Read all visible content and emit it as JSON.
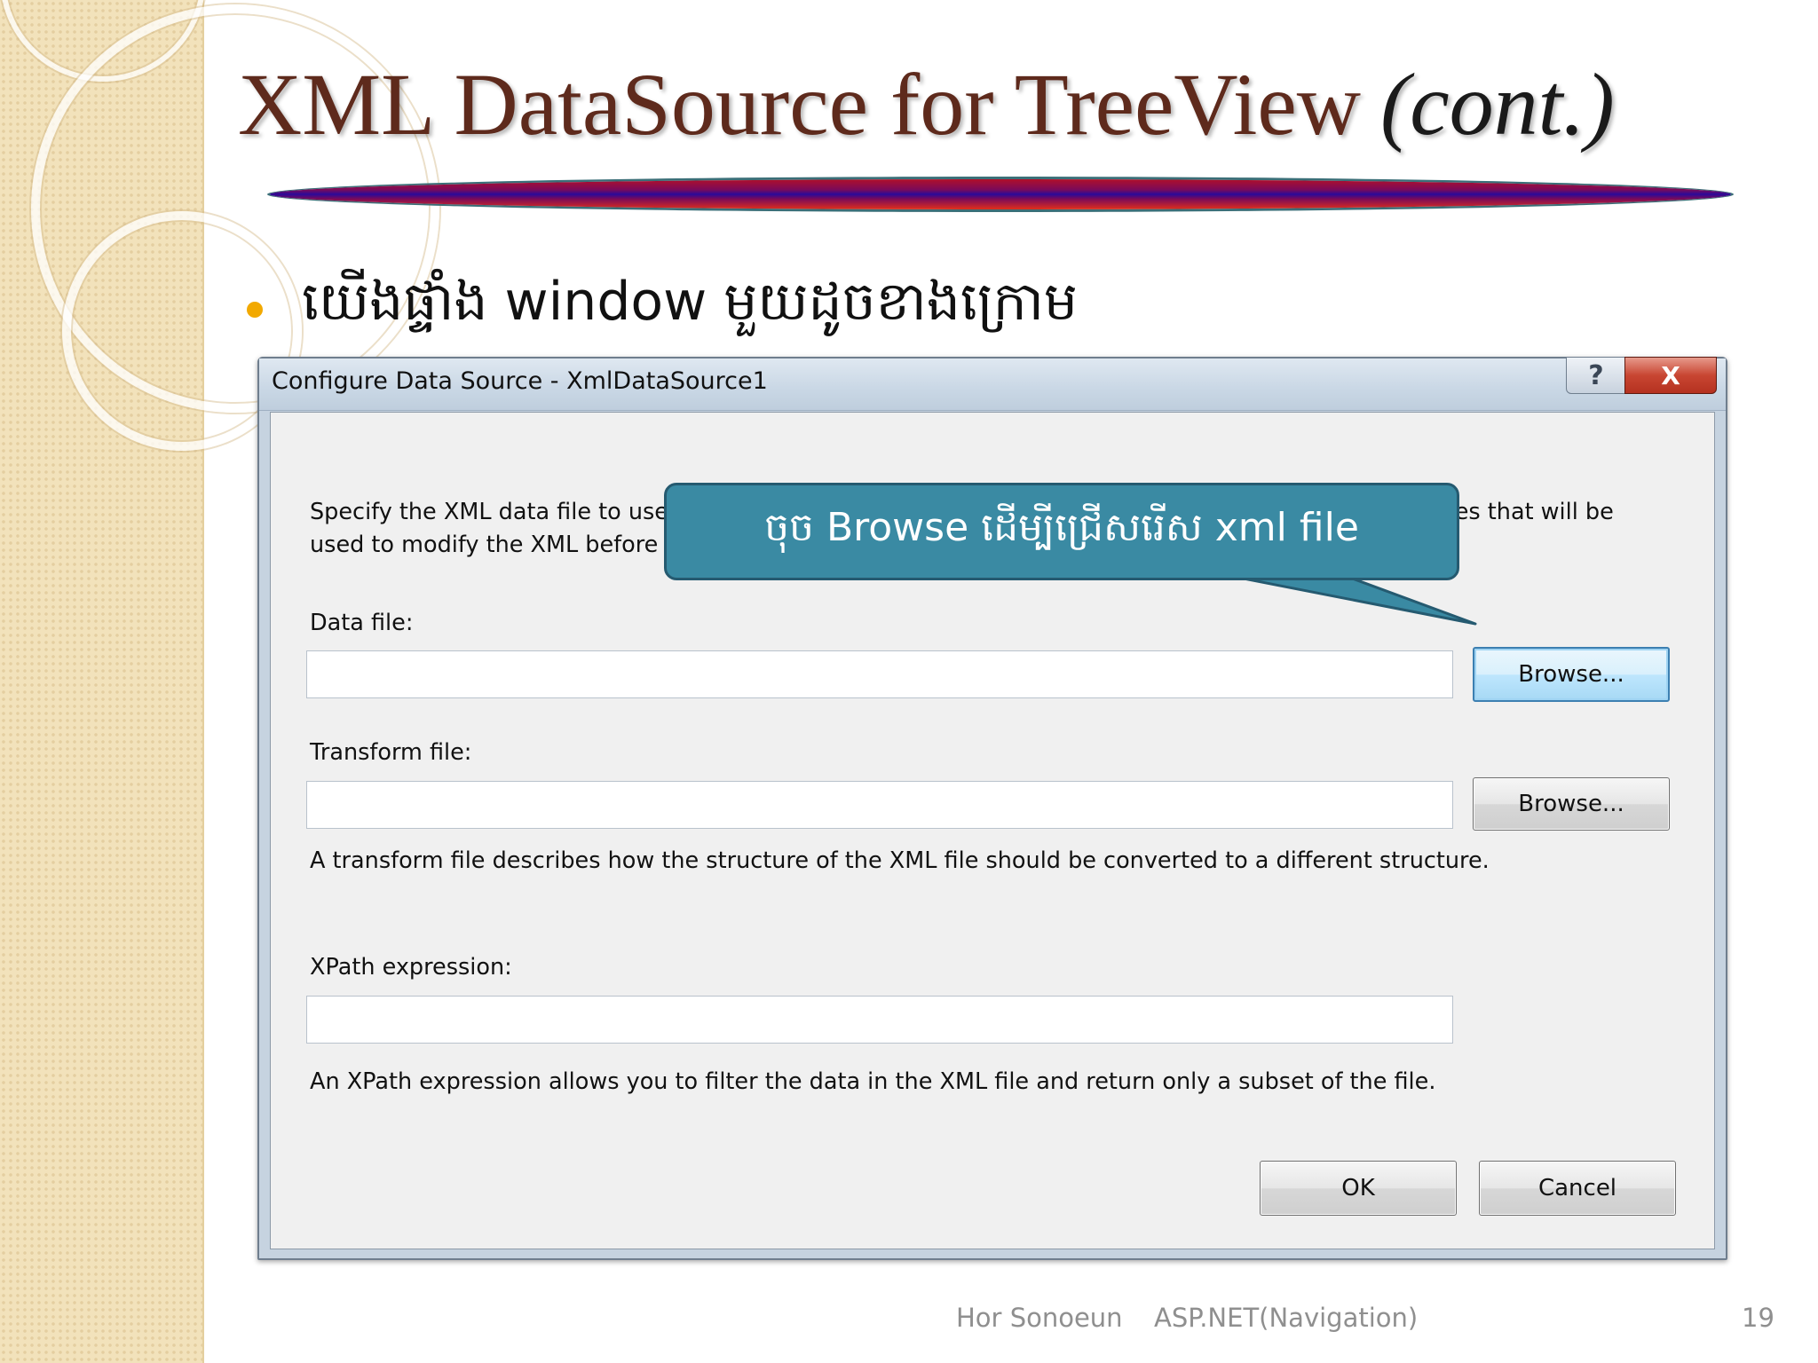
{
  "slide": {
    "title_main": "XML DataSource for TreeView",
    "title_suffix": "(cont.)",
    "bullet": "យើងផ្ទាំង window មួយដូចខាងក្រោម",
    "callout": "ចុច Browse ដើម្បីជ្រើសរើស xml file",
    "footer_author": "Hor Sonoeun",
    "footer_topic": "ASP.NET(Navigation)",
    "page_number": "19",
    "colors": {
      "title": "#5e2a1c",
      "bullet": "#f2a900",
      "callout_fill": "#3a8aa3",
      "left_band": "#f2e2bb"
    }
  },
  "dialog": {
    "title": "Configure Data Source - XmlDataSource1",
    "help_label": "?",
    "close_label": "X",
    "description": "Specify the XML data file to use as the source for this control. You can optionally specify additional files that will be used to modify the XML before it is used by the control.",
    "data_file": {
      "label": "Data file:",
      "value": "",
      "browse_label": "Browse..."
    },
    "transform_file": {
      "label": "Transform file:",
      "value": "",
      "browse_label": "Browse...",
      "hint": "A transform file describes how the structure of the XML file should be converted to a different structure."
    },
    "xpath": {
      "label": "XPath expression:",
      "value": "",
      "hint": "An XPath expression allows you to filter the data in the XML file and return only a subset of the file."
    },
    "ok_label": "OK",
    "cancel_label": "Cancel"
  }
}
